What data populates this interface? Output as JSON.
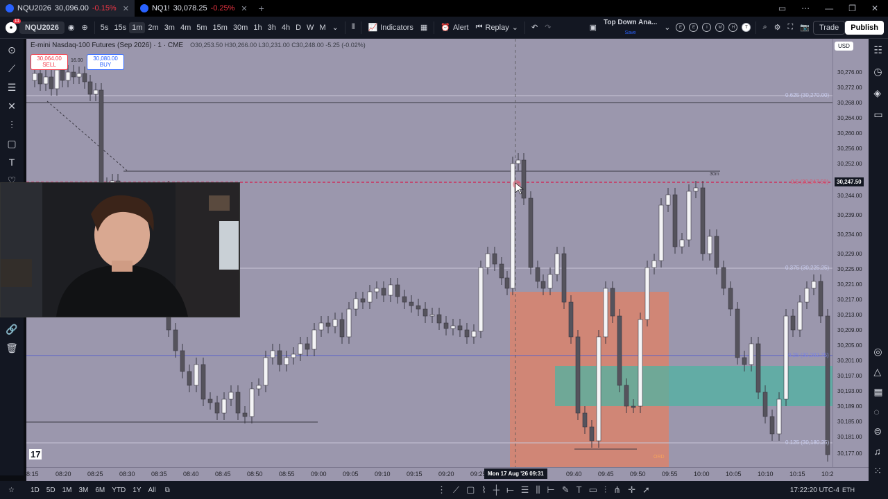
{
  "tabs": [
    {
      "symbol": "NQU2026",
      "price": "30,096.00",
      "change": "-0.15%",
      "active": true
    },
    {
      "symbol": "NQ1!",
      "price": "30,078.25",
      "change": "-0.25%",
      "active": false
    }
  ],
  "toolbar": {
    "avatar_badge": "11",
    "symbol": "NQU2026",
    "timeframes": [
      "5s",
      "15s",
      "1m",
      "2m",
      "3m",
      "4m",
      "5m",
      "15m",
      "30m",
      "1h",
      "3h",
      "4h",
      "D",
      "W",
      "M"
    ],
    "active_timeframe": "1m",
    "indicators_label": "Indicators",
    "alert_label": "Alert",
    "replay_label": "Replay",
    "layout_name": "Top Down Ana...",
    "layout_status": "Save",
    "layout_circles": [
      "E",
      "E",
      "I",
      "M",
      "H",
      "T"
    ],
    "trade_label": "Trade",
    "publish_label": "Publish"
  },
  "chart": {
    "title": "E-mini Nasdaq-100 Futures (Sep 2026) · 1 · CME",
    "ohlc": "O30,253.50 H30,266.00 L30,231.00 C30,248.00 -5.25 (-0.02%)",
    "sell_price": "30,064.00",
    "sell_label": "SELL",
    "buy_price": "30,080.00",
    "buy_label": "BUY",
    "spread": "16.00",
    "currency": "USD",
    "current_price": "30,247.50",
    "fib_levels": [
      {
        "label": "0.625 (30,270.00)"
      },
      {
        "label": "0.5 (30,247.50)"
      },
      {
        "label": "0.375 (30,225.25)"
      },
      {
        "label": "0.25 (30,202.75)"
      },
      {
        "label": "0.125 (30,180.25)"
      }
    ],
    "tf_label": "30m",
    "position_label": "ORD",
    "price_ticks": [
      "30,276.00",
      "30,272.00",
      "30,268.00",
      "30,264.00",
      "30,260.00",
      "30,256.00",
      "30,252.00",
      "30,244.00",
      "30,239.00",
      "30,234.00",
      "30,229.00",
      "30,225.00",
      "30,221.00",
      "30,217.00",
      "30,213.00",
      "30,209.00",
      "30,205.00",
      "30,201.00",
      "30,197.00",
      "30,193.00",
      "30,189.00",
      "30,185.00",
      "30,181.00",
      "30,177.00"
    ],
    "time_ticks": [
      "8:15",
      "08:20",
      "08:25",
      "08:30",
      "08:35",
      "08:40",
      "08:45",
      "08:50",
      "08:55",
      "09:00",
      "09:05",
      "09:10",
      "09:15",
      "09:20",
      "09:25",
      "09:40",
      "09:45",
      "09:50",
      "09:55",
      "10:00",
      "10:05",
      "10:10",
      "10:15",
      "10:2"
    ],
    "crosshair_time": "Mon 17 Aug '26  09:31"
  },
  "bottombar": {
    "ranges": [
      "1D",
      "5D",
      "1M",
      "3M",
      "6M",
      "YTD",
      "1Y",
      "All"
    ],
    "clock": "17:22:20 UTC-4",
    "session": "ETH"
  }
}
